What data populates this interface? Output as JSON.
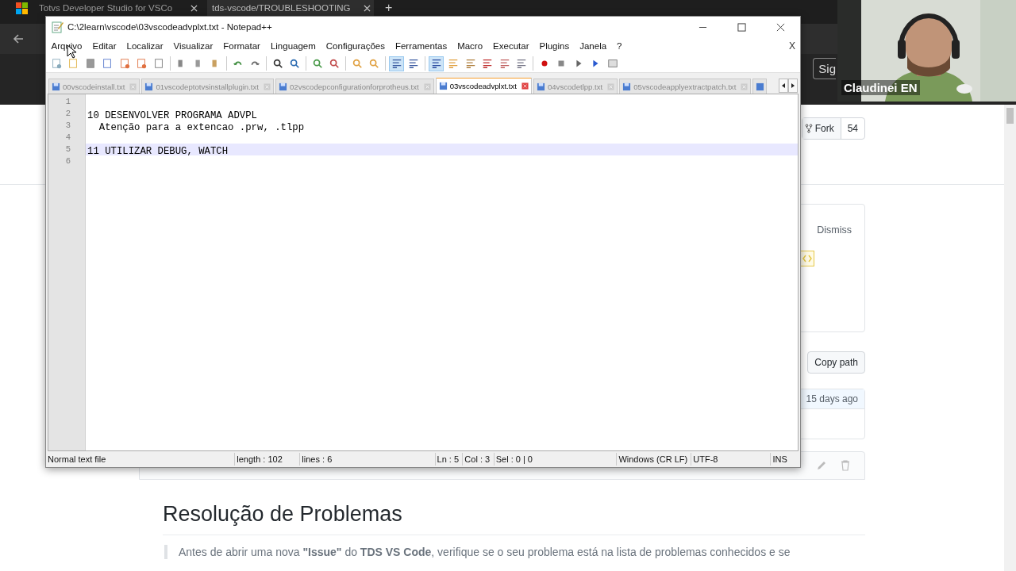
{
  "browser": {
    "tabs": [
      {
        "title": "Totvs Developer Studio for VSCo",
        "selected": false
      },
      {
        "title": "tds-vscode/TROUBLESHOOTING",
        "selected": true
      }
    ],
    "new_tab": "+",
    "header_button": "Sig",
    "page": {
      "fork_label": "Fork",
      "fork_count": "54",
      "dismiss": "Dismiss",
      "copy_path": "Copy path",
      "commit_age": "15 days ago",
      "heading": "Resolução de Problemas",
      "paragraph": "Antes de abrir uma nova **\"Issue\"** do **TDS VS Code**, verifique se o seu problema está na lista de problemas conhecidos e se"
    }
  },
  "notepad": {
    "title": "C:\\2learn\\vscode\\03vscodeadvplxt.txt - Notepad++",
    "menu": [
      "Arquivo",
      "Editar",
      "Localizar",
      "Visualizar",
      "Formatar",
      "Linguagem",
      "Configurações",
      "Ferramentas",
      "Macro",
      "Executar",
      "Plugins",
      "Janela",
      "?"
    ],
    "close_doc": "X",
    "toolbar": [
      {
        "pressed": false
      },
      {
        "pressed": false
      },
      {
        "pressed": false
      },
      {
        "pressed": false
      },
      {
        "pressed": false
      },
      {
        "pressed": false
      },
      {
        "pressed": false
      },
      {
        "pressed": false
      },
      {
        "pressed": false
      },
      {
        "pressed": false
      },
      {
        "pressed": false
      },
      {
        "pressed": false
      },
      {
        "pressed": false
      },
      {
        "pressed": false
      },
      {
        "pressed": false
      },
      {
        "pressed": false
      },
      {
        "pressed": false
      },
      {
        "pressed": false
      },
      {
        "pressed": true
      },
      {
        "pressed": false
      },
      {
        "pressed": true
      },
      {
        "pressed": false
      },
      {
        "pressed": false
      },
      {
        "pressed": false
      },
      {
        "pressed": false
      },
      {
        "pressed": false
      },
      {
        "pressed": false
      },
      {
        "pressed": false
      },
      {
        "pressed": false
      },
      {
        "pressed": false
      },
      {
        "pressed": false
      }
    ],
    "tabs": [
      {
        "label": "00vscodeinstall.txt",
        "selected": false
      },
      {
        "label": "01vscodeptotvsinstallplugin.txt",
        "selected": false
      },
      {
        "label": "02vscodepconfigurationforprotheus.txt",
        "selected": false
      },
      {
        "label": "03vscodeadvplxt.txt",
        "selected": true
      },
      {
        "label": "04vscodetlpp.txt",
        "selected": false
      },
      {
        "label": "05vscodeapplyextractpatch.txt",
        "selected": false
      }
    ],
    "lines": [
      {
        "number": "1",
        "current": false
      },
      {
        "number": "2",
        "text": "10 DESENVOLVER PROGRAMA ADVPL",
        "current": false
      },
      {
        "number": "3",
        "text": "  Atenção para a extencao .prw, .tlpp",
        "current": false
      },
      {
        "number": "4",
        "current": false
      },
      {
        "number": "5",
        "text": "11 UTILIZAR DEBUG, WATCH",
        "current": true
      },
      {
        "number": "6",
        "current": false
      }
    ],
    "status": {
      "file_type": "Normal text file",
      "length": "length : 102",
      "lines": "lines : 6",
      "ln": "Ln : 5",
      "col": "Col : 3",
      "sel": "Sel : 0 | 0",
      "eol": "Windows (CR LF)",
      "encoding": "UTF-8",
      "mode": "INS"
    }
  },
  "webcam": {
    "name": "Claudinei EN"
  }
}
